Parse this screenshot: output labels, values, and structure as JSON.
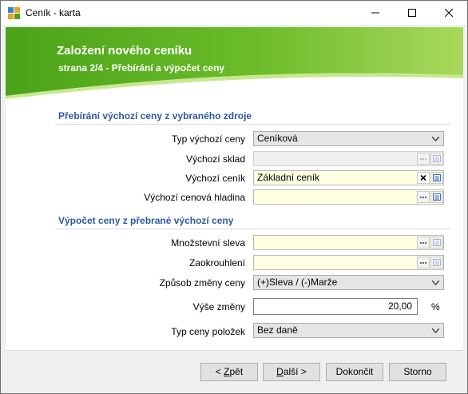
{
  "window": {
    "title": "Ceník - karta",
    "controls": {
      "minimize": "minimize-icon",
      "maximize": "maximize-icon",
      "close": "close-icon"
    }
  },
  "banner": {
    "title": "Založení nového ceníku",
    "subtitle": "strana 2/4 - Přebírání a výpočet ceny",
    "colors": {
      "green_dark": "#4aa318",
      "green_light": "#b7e06b"
    }
  },
  "section1": {
    "title": "Přebírání výchozí ceny z vybraného zdroje",
    "fields": [
      {
        "label": "Typ výchozí ceny",
        "value": "Ceníková",
        "kind": "combo"
      },
      {
        "label": "Výchozí sklad",
        "value": "",
        "kind": "disabled"
      },
      {
        "label": "Výchozí ceník",
        "value": "Základní ceník",
        "kind": "lookup-clear"
      },
      {
        "label": "Výchozí cenová hladina",
        "value": "",
        "kind": "lookup"
      }
    ]
  },
  "section2": {
    "title": "Výpočet ceny z přebrané výchozí ceny",
    "fields": [
      {
        "label": "Množstevní sleva",
        "value": "",
        "kind": "lookup"
      },
      {
        "label": "Zaokrouhlení",
        "value": "",
        "kind": "lookup"
      },
      {
        "label": "Způsob změny ceny",
        "value": "(+)Sleva / (-)Marže",
        "kind": "combo"
      },
      {
        "label": "Výše změny",
        "value": "20,00",
        "unit": "%",
        "kind": "number"
      },
      {
        "label": "Typ ceny položek",
        "value": "Bez daně",
        "kind": "combo"
      }
    ]
  },
  "buttons": {
    "back": {
      "accel": "Z",
      "before": "< ",
      "after": "pět"
    },
    "next": {
      "accel": "D",
      "before": "",
      "after": "alší >"
    },
    "finish": "Dokončit",
    "cancel": "Storno"
  },
  "icons": {
    "ellipsis": "ellipsis-icon",
    "list": "list-icon",
    "clear": "clear-x-icon",
    "dropdown": "chevron-down-icon"
  }
}
